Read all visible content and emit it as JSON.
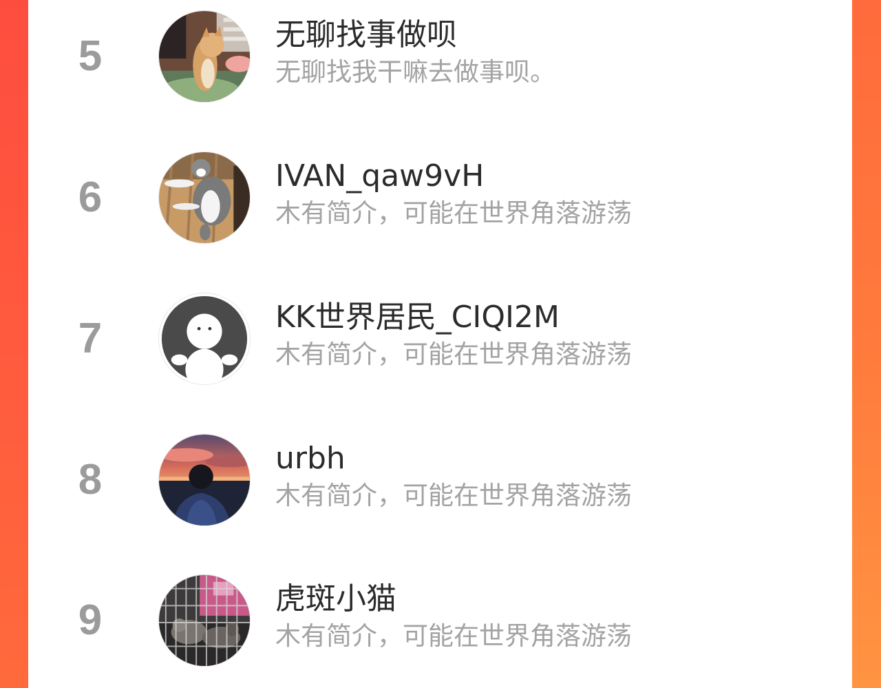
{
  "users": [
    {
      "rank": "5",
      "name": "无聊找事做呗",
      "bio": "无聊找我干嘛去做事呗。",
      "avatar_icon": "cat-photo-avatar-icon"
    },
    {
      "rank": "6",
      "name": "IVAN_qaw9vH",
      "bio": "木有简介，可能在世界角落游荡",
      "avatar_icon": "cat-lying-avatar-icon"
    },
    {
      "rank": "7",
      "name": "KK世界居民_CIQI2M",
      "bio": "木有简介，可能在世界角落游荡",
      "avatar_icon": "default-person-avatar-icon"
    },
    {
      "rank": "8",
      "name": "urbh",
      "bio": "木有简介，可能在世界角落游荡",
      "avatar_icon": "sunset-person-avatar-icon"
    },
    {
      "rank": "9",
      "name": "虎斑小猫",
      "bio": "木有简介，可能在世界角落游荡",
      "avatar_icon": "caged-cats-avatar-icon"
    }
  ],
  "colors": {
    "background_gradient_start": "#ff5a3d",
    "background_gradient_end": "#ff8f3e",
    "panel": "#ffffff",
    "rank_text": "#9b9b9b",
    "name_text": "#2b2b2b",
    "bio_text": "#a3a3a3"
  }
}
